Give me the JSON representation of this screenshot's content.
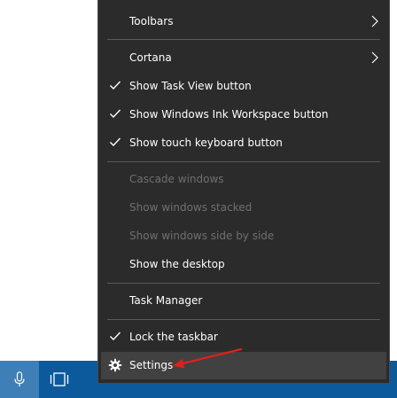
{
  "context_menu": {
    "items": [
      {
        "label": "Toolbars",
        "submenu": true
      },
      {
        "label": "Cortana",
        "submenu": true
      },
      {
        "label": "Show Task View button",
        "checked": true
      },
      {
        "label": "Show Windows Ink Workspace button",
        "checked": true
      },
      {
        "label": "Show touch keyboard button",
        "checked": true
      },
      {
        "label": "Cascade windows",
        "disabled": true
      },
      {
        "label": "Show windows stacked",
        "disabled": true
      },
      {
        "label": "Show windows side by side",
        "disabled": true
      },
      {
        "label": "Show the desktop"
      },
      {
        "label": "Task Manager"
      },
      {
        "label": "Lock the taskbar",
        "checked": true
      },
      {
        "label": "Settings",
        "icon": "gear-icon",
        "selected": true
      }
    ]
  },
  "taskbar": {
    "buttons": [
      {
        "icon": "microphone-icon"
      },
      {
        "icon": "task-view-icon"
      }
    ]
  },
  "annotation": {
    "arrow_color": "#e0201c"
  },
  "colors": {
    "menu_background": "#2b2b2b",
    "menu_hover": "#414141",
    "taskbar": "#0c5a9c",
    "disabled_text": "#6f6f6f"
  }
}
